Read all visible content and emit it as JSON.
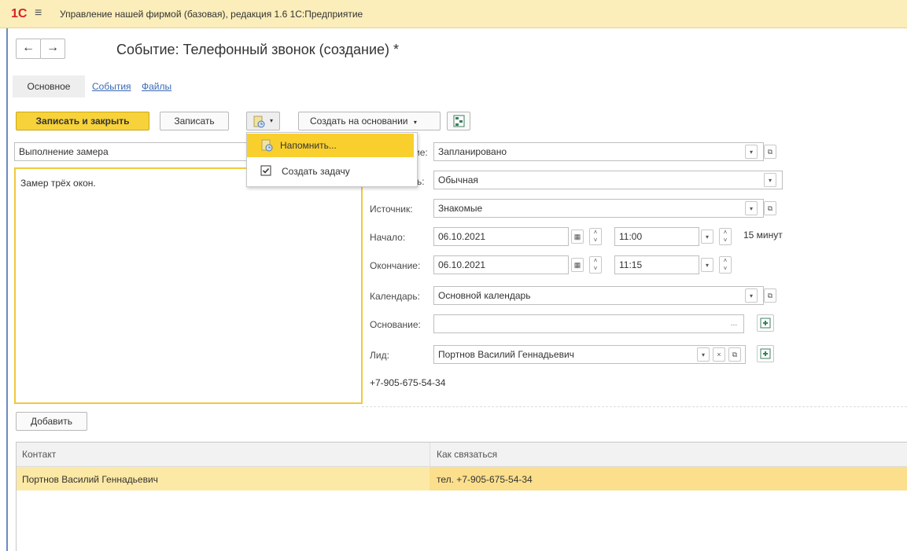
{
  "app": {
    "logo": "1С",
    "title": "Управление нашей фирмой (базовая), редакция 1.6 1С:Предприятие"
  },
  "form": {
    "title": "Событие: Телефонный звонок (создание) *"
  },
  "tabs": [
    "Основное",
    "События",
    "Файлы"
  ],
  "toolbar": {
    "save_close": "Записать и закрыть",
    "save": "Записать",
    "create_basis": "Создать на основании"
  },
  "menu": {
    "items": [
      "Напомнить...",
      "Создать задачу"
    ]
  },
  "subject": {
    "value": "Выполнение замера"
  },
  "comment": {
    "value": "Замер трёх окон."
  },
  "fields": {
    "state": {
      "label_partial": "ие:",
      "value": "Запланировано"
    },
    "importance": {
      "label_partial": "ь:",
      "value": "Обычная"
    },
    "source": {
      "label": "Источник:",
      "value": "Знакомые"
    },
    "start": {
      "label": "Начало:",
      "date": "06.10.2021",
      "time": "11:00",
      "duration": "15 минут"
    },
    "end": {
      "label": "Окончание:",
      "date": "06.10.2021",
      "time": "11:15"
    },
    "calendar": {
      "label": "Календарь:",
      "value": "Основной календарь"
    },
    "basis": {
      "label": "Основание:",
      "value": ""
    },
    "lead": {
      "label": "Лид:",
      "value": "Портнов Василий Геннадьевич"
    },
    "phone": "+7-905-675-54-34"
  },
  "participants": {
    "add_button": "Добавить",
    "columns": [
      "Контакт",
      "Как связаться"
    ],
    "rows": [
      {
        "contact": "Портнов Василий Геннадьевич",
        "how": "тел. +7-905-675-54-34"
      }
    ]
  },
  "colors": {
    "titlebar": "#fbeeba",
    "accent": "#f7d23a",
    "selection": "#fce9a5",
    "link": "#3a6ab5"
  }
}
